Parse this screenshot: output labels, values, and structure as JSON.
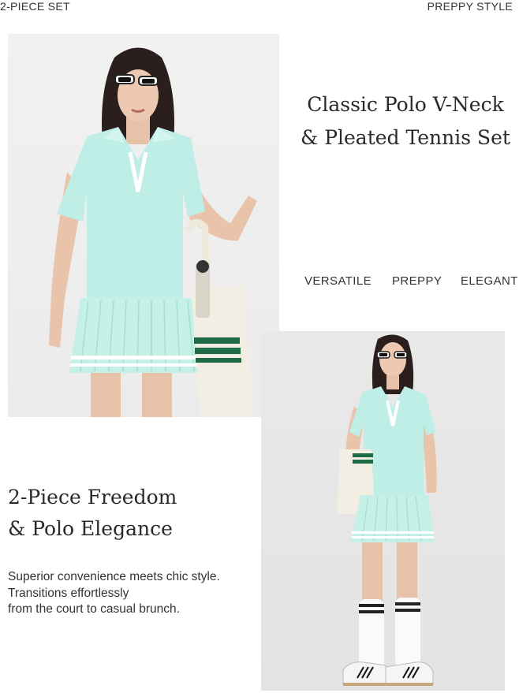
{
  "header": {
    "left_label": "2-PIECE SET",
    "right_label": "PREPPY STYLE"
  },
  "hero": {
    "title_line1": "Classic Polo V-Neck",
    "title_line2": "& Pleated Tennis Set"
  },
  "tags": [
    "VERSATILE",
    "PREPPY",
    "ELEGANT"
  ],
  "feature": {
    "title_line1": "2-Piece Freedom",
    "title_line2": "& Polo Elegance",
    "desc_line1": "Superior convenience meets chic style.",
    "desc_line2": "Transitions effortlessly",
    "desc_line3": "from the court to casual brunch."
  },
  "colors": {
    "outfit_mint": "#bfeee6",
    "accent_green": "#1f6b45",
    "text": "#2f2f2f"
  }
}
